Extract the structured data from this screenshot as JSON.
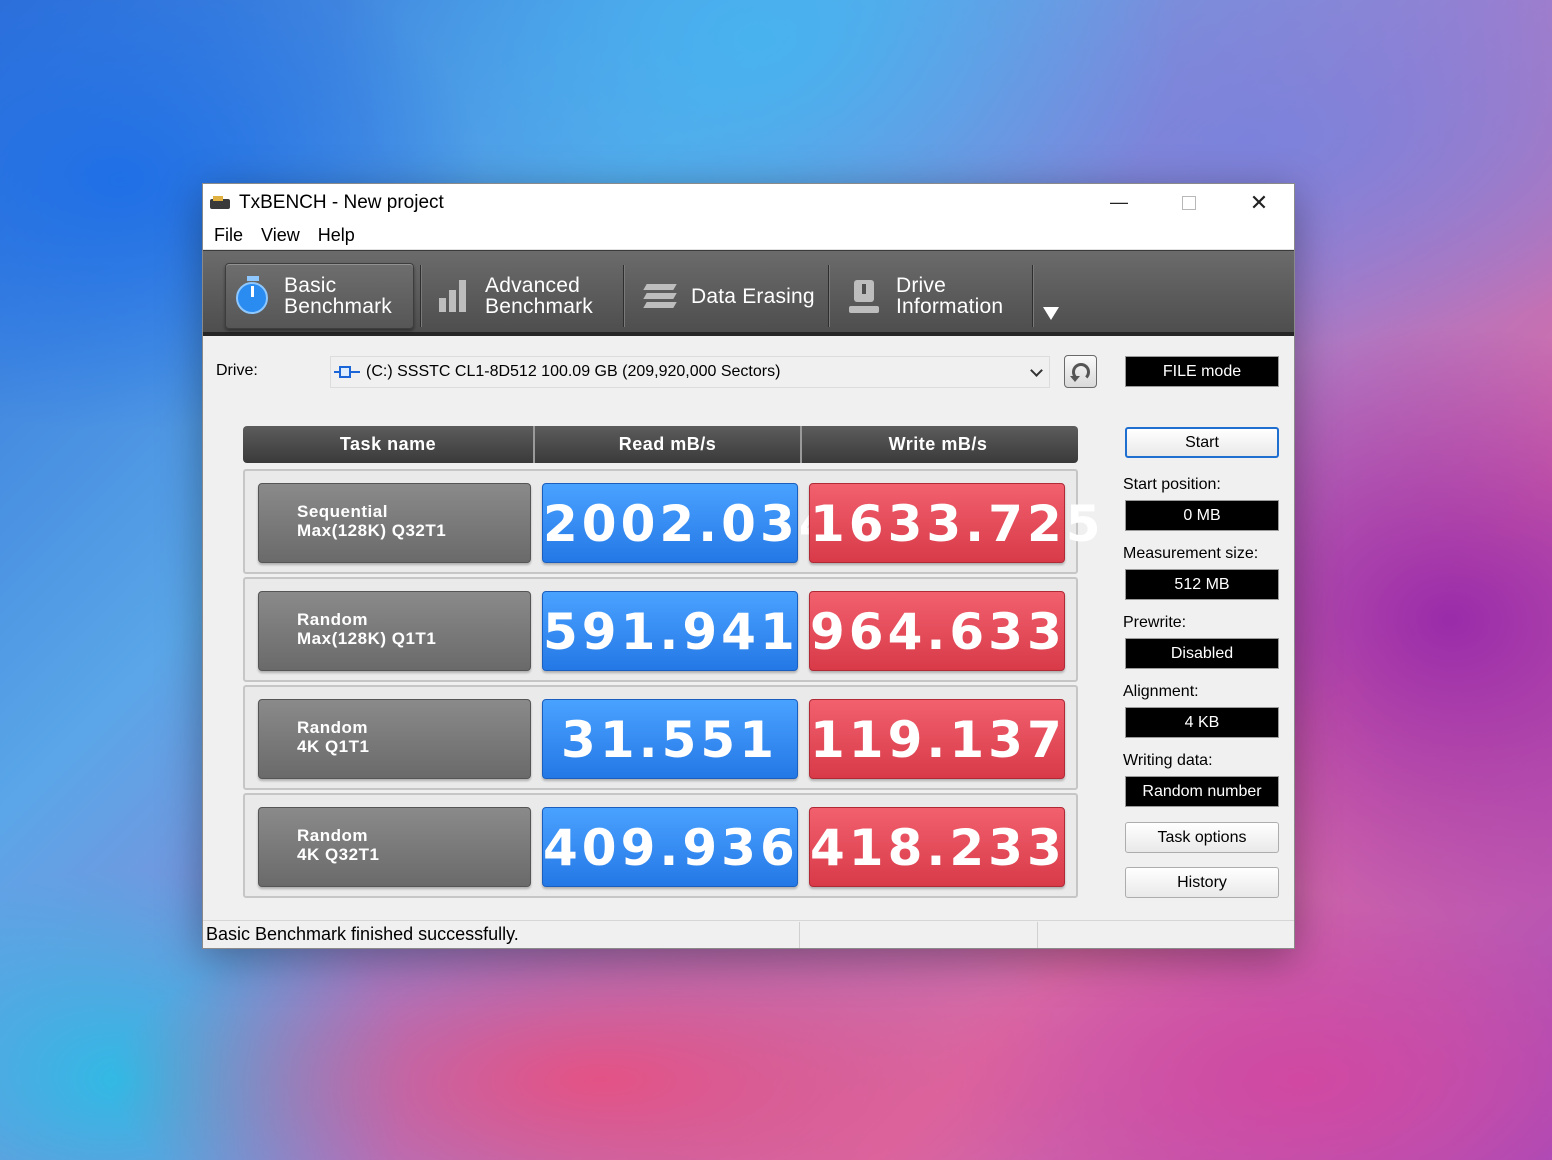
{
  "window": {
    "title": "TxBENCH - New project",
    "controls": {
      "minimize": "—",
      "close": "✕"
    }
  },
  "menu": [
    "File",
    "View",
    "Help"
  ],
  "tabs": [
    {
      "line1": "Basic",
      "line2": "Benchmark",
      "icon": "stopwatch-icon",
      "active": true
    },
    {
      "line1": "Advanced",
      "line2": "Benchmark",
      "icon": "bar-chart-icon",
      "active": false
    },
    {
      "line1": "Data Erasing",
      "line2": "",
      "icon": "erase-icon",
      "active": false
    },
    {
      "line1": "Drive",
      "line2": "Information",
      "icon": "drive-info-icon",
      "active": false
    }
  ],
  "drive": {
    "label": "Drive:",
    "selected": "(C:) SSSTC CL1-8D512  100.09 GB (209,920,000 Sectors)"
  },
  "mode": "FILE mode",
  "start_label": "Start",
  "settings": {
    "start_position": {
      "label": "Start position:",
      "value": "0 MB"
    },
    "measurement_size": {
      "label": "Measurement size:",
      "value": "512 MB"
    },
    "prewrite": {
      "label": "Prewrite:",
      "value": "Disabled"
    },
    "alignment": {
      "label": "Alignment:",
      "value": "4 KB"
    },
    "writing_data": {
      "label": "Writing data:",
      "value": "Random number"
    }
  },
  "task_options_label": "Task options",
  "history_label": "History",
  "table": {
    "headers": [
      "Task name",
      "Read mB/s",
      "Write mB/s"
    ],
    "rows": [
      {
        "name1": "Sequential",
        "name2": "Max(128K) Q32T1",
        "read": "2002.034",
        "write": "1633.725"
      },
      {
        "name1": "Random",
        "name2": "Max(128K) Q1T1",
        "read": "591.941",
        "write": "964.633"
      },
      {
        "name1": "Random",
        "name2": "4K Q1T1",
        "read": "31.551",
        "write": "119.137"
      },
      {
        "name1": "Random",
        "name2": "4K Q32T1",
        "read": "409.936",
        "write": "418.233"
      }
    ]
  },
  "status": "Basic Benchmark finished successfully.",
  "colors": {
    "read": "#2f86f0",
    "write": "#e04a58",
    "toolbar": "#5a5a5a"
  }
}
